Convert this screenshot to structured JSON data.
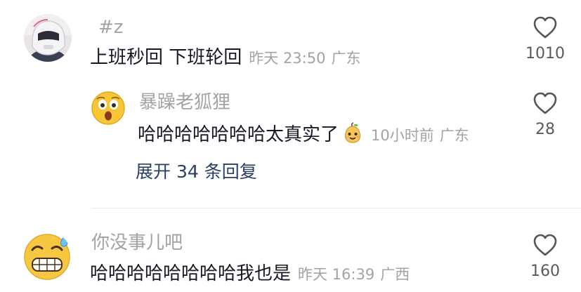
{
  "comments": [
    {
      "username": "#z",
      "text": "上班秒回 下班轮回",
      "time": "昨天 23:50",
      "location": "广东",
      "like_count": "1010",
      "replies": [
        {
          "username": "暴躁老狐狸",
          "text": "哈哈哈哈哈哈哈太真实了",
          "emoji": "pear-face-emoji",
          "time": "10小时前",
          "location": "广东",
          "like_count": "28"
        }
      ],
      "expand_label": "展开 34 条回复"
    },
    {
      "username": "你没事儿吧",
      "text": "哈哈哈哈哈哈哈哈我也是",
      "time": "昨天 16:39",
      "location": "广西",
      "like_count": "160"
    }
  ],
  "icons": {
    "like": "heart-outline-icon"
  },
  "colors": {
    "username": "#a3a3a3",
    "comment_text": "#161823",
    "expand_link": "#2c3e62",
    "divider": "#ebebeb"
  }
}
